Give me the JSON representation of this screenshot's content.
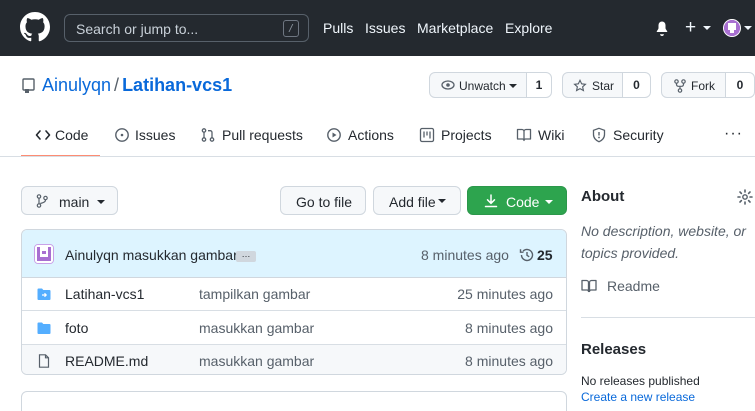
{
  "header": {
    "search_placeholder": "Search or jump to...",
    "search_shortcut": "/",
    "nav": [
      "Pulls",
      "Issues",
      "Marketplace",
      "Explore"
    ],
    "plus": "+",
    "background": "#24292f"
  },
  "repo": {
    "owner": "Ainulyqn",
    "separator": "/",
    "name": "Latihan-vcs1",
    "watch_label": "Unwatch",
    "watch_count": "1",
    "star_label": "Star",
    "star_count": "0",
    "fork_label": "Fork",
    "fork_count": "0"
  },
  "tabs": [
    {
      "label": "Code",
      "icon": "code-icon",
      "selected": true
    },
    {
      "label": "Issues",
      "icon": "issue-icon"
    },
    {
      "label": "Pull requests",
      "icon": "pull-request-icon"
    },
    {
      "label": "Actions",
      "icon": "play-icon"
    },
    {
      "label": "Projects",
      "icon": "project-icon"
    },
    {
      "label": "Wiki",
      "icon": "book-icon"
    },
    {
      "label": "Security",
      "icon": "shield-icon"
    }
  ],
  "tabs_more": "···",
  "toolbar": {
    "branch": "main",
    "go_to_file": "Go to file",
    "add_file": "Add file",
    "code": "Code",
    "code_color": "#2da44e"
  },
  "commit": {
    "author": "Ainulyqn",
    "message": "masukkan gambar",
    "ellipsis": "…",
    "time": "8 minutes ago",
    "count": "25"
  },
  "files": [
    {
      "name": "Latihan-vcs1",
      "type": "submodule",
      "message": "tampilkan gambar",
      "time": "25 minutes ago"
    },
    {
      "name": "foto",
      "type": "folder",
      "message": "masukkan gambar",
      "time": "8 minutes ago"
    },
    {
      "name": "README.md",
      "type": "file",
      "message": "masukkan gambar",
      "time": "8 minutes ago"
    }
  ],
  "about": {
    "title": "About",
    "description": "No description, website, or topics provided.",
    "readme": "Readme"
  },
  "releases": {
    "title": "Releases",
    "none": "No releases published",
    "create": "Create a new release"
  }
}
